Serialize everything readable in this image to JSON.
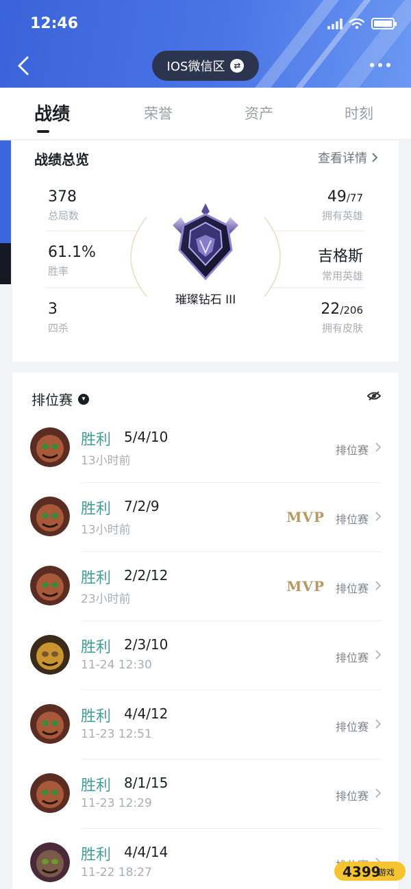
{
  "status_bar": {
    "time": "12:46"
  },
  "header": {
    "zone_label": "IOS微信区"
  },
  "tabs": [
    "战绩",
    "荣誉",
    "资产",
    "时刻"
  ],
  "overview": {
    "title": "战绩总览",
    "detail_link": "查看详情",
    "left_stats": [
      {
        "value": "378",
        "label": "总局数"
      },
      {
        "value": "61.1%",
        "label": "胜率"
      },
      {
        "value": "3",
        "label": "四杀"
      }
    ],
    "right_stats": [
      {
        "value_main": "49",
        "value_sub": "/77",
        "label": "拥有英雄"
      },
      {
        "value_main": "吉格斯",
        "value_sub": "",
        "label": "常用英雄"
      },
      {
        "value_main": "22",
        "value_sub": "/206",
        "label": "拥有皮肤"
      }
    ],
    "rank_name": "璀璨钻石 III"
  },
  "ranked": {
    "title": "排位赛",
    "matches": [
      {
        "result": "胜利",
        "kda": "5/4/10",
        "time": "13小时前",
        "mvp": "",
        "mode": "排位赛"
      },
      {
        "result": "胜利",
        "kda": "7/2/9",
        "time": "13小时前",
        "mvp": "MVP",
        "mode": "排位赛"
      },
      {
        "result": "胜利",
        "kda": "2/2/12",
        "time": "23小时前",
        "mvp": "MVP",
        "mode": "排位赛"
      },
      {
        "result": "胜利",
        "kda": "2/3/10",
        "time": "11-24 12:30",
        "mvp": "",
        "mode": "排位赛"
      },
      {
        "result": "胜利",
        "kda": "4/4/12",
        "time": "11-23 12:51",
        "mvp": "",
        "mode": "排位赛"
      },
      {
        "result": "胜利",
        "kda": "8/1/15",
        "time": "11-23 12:29",
        "mvp": "",
        "mode": "排位赛"
      },
      {
        "result": "胜利",
        "kda": "4/4/14",
        "time": "11-22 18:27",
        "mvp": "",
        "mode": "排位赛"
      }
    ]
  },
  "watermark": "4399游戏",
  "colors": {
    "header_blue": "#3a63d9",
    "win_green": "#3f9e98",
    "mvp_gold": "#b69a62"
  }
}
